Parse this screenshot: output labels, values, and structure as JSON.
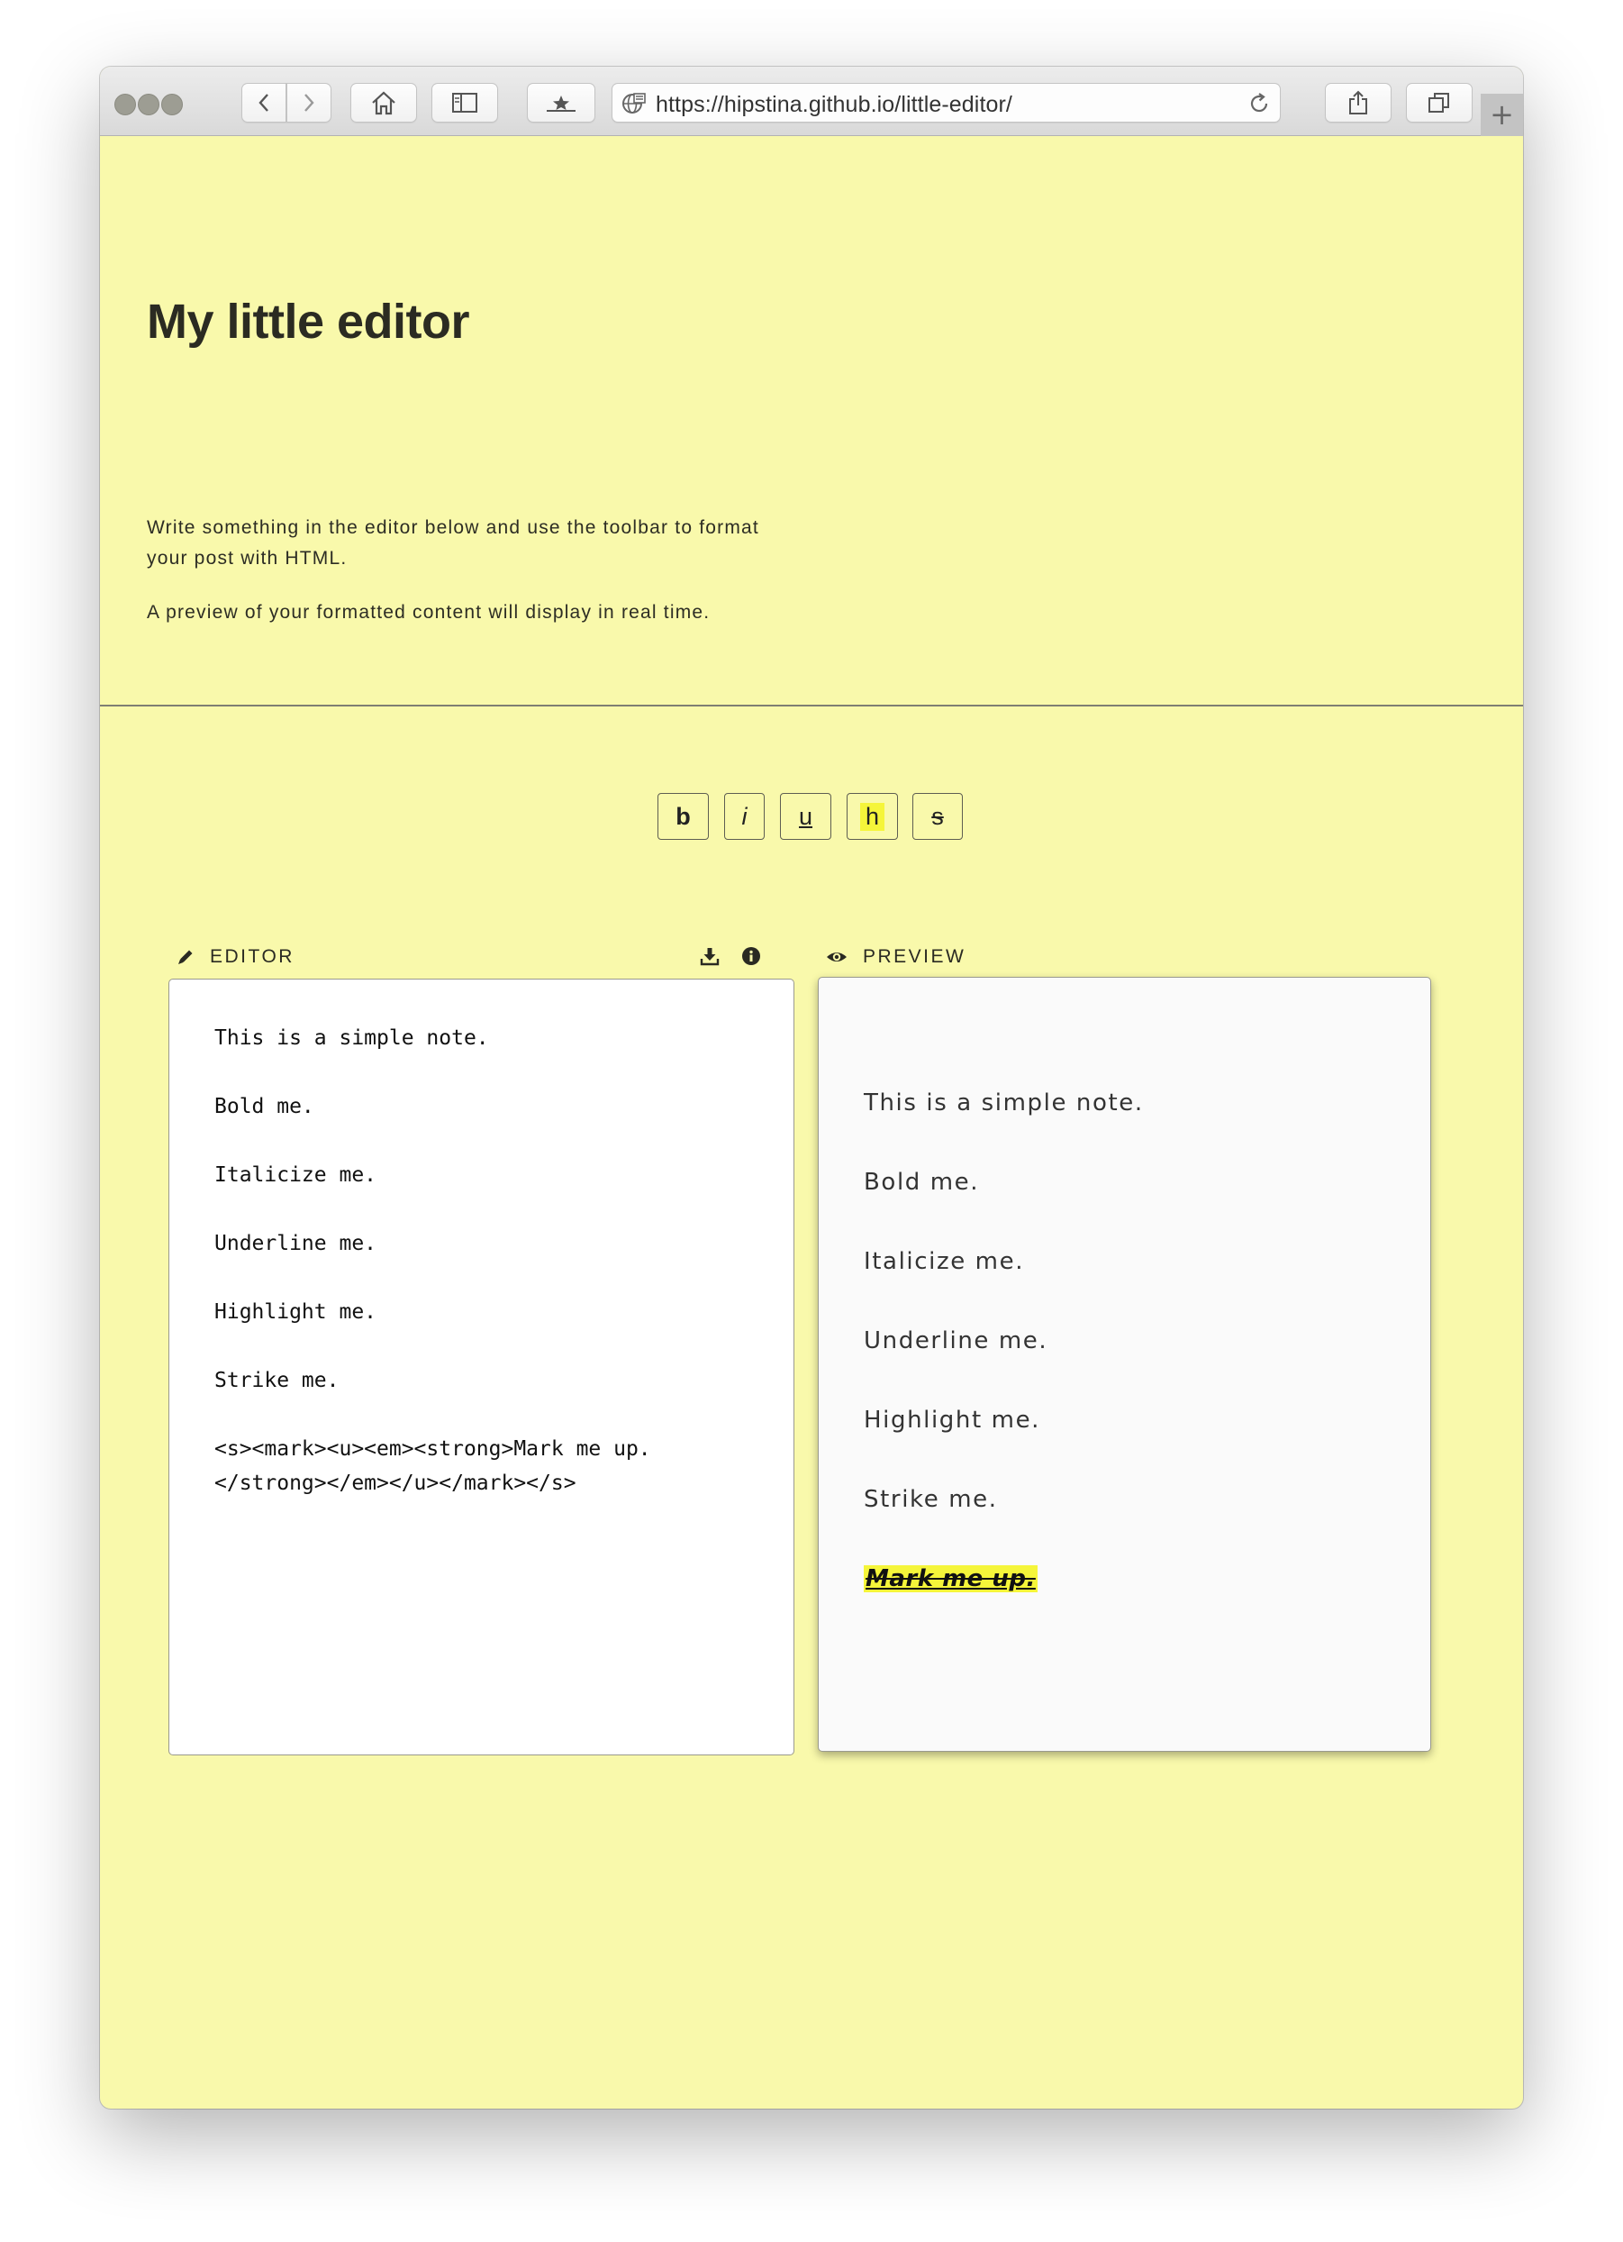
{
  "browser": {
    "url": "https://hipstina.github.io/little-editor/",
    "new_tab": "+"
  },
  "page": {
    "title": "My little editor",
    "intro": [
      "Write something in the editor below and use the toolbar to format your post with HTML.",
      "A preview of your formatted content will display in real time."
    ]
  },
  "toolbar": {
    "bold": "b",
    "italic": "i",
    "underline": "u",
    "highlight": "h",
    "strike": "s",
    "highlight_color": "#f5f53a"
  },
  "editor": {
    "label": "EDITOR",
    "lines": [
      "This is a simple note.",
      "Bold me.",
      "Italicize me.",
      "Underline me.",
      "Highlight me.",
      "Strike me.",
      "<s><mark><u><em><strong>Mark me up.",
      "</strong></em></u></mark></s>"
    ]
  },
  "preview": {
    "label": "PREVIEW",
    "lines": [
      "This is a simple note.",
      "Bold me.",
      "Italicize me.",
      "Underline me.",
      "Highlight me.",
      "Strike me."
    ],
    "marked": "Mark me up."
  },
  "colors": {
    "page_background": "#f9f9ab",
    "highlight": "#f5f53a"
  }
}
